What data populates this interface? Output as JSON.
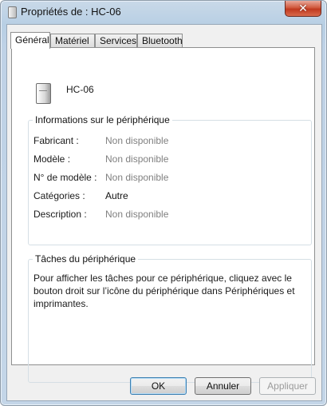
{
  "window": {
    "title": "Propriétés de : HC-06",
    "close_glyph": "✕"
  },
  "tabs": [
    {
      "label": "Général",
      "active": true
    },
    {
      "label": "Matériel",
      "active": false
    },
    {
      "label": "Services",
      "active": false
    },
    {
      "label": "Bluetooth",
      "active": false
    }
  ],
  "device": {
    "name": "HC-06",
    "icon": "device-icon"
  },
  "info": {
    "legend": "Informations sur le périphérique",
    "rows": [
      {
        "label": "Fabricant :",
        "value": "Non disponible"
      },
      {
        "label": "Modèle :",
        "value": "Non disponible"
      },
      {
        "label": "N° de modèle :",
        "value": "Non disponible"
      },
      {
        "label": "Catégories :",
        "value": "Autre"
      },
      {
        "label": "Description :",
        "value": "Non disponible"
      }
    ]
  },
  "tasks": {
    "legend": "Tâches du périphérique",
    "text": "Pour afficher les tâches pour ce périphérique, cliquez avec le bouton droit sur l’icône du périphérique dans Périphériques et imprimantes."
  },
  "buttons": {
    "ok": "OK",
    "cancel": "Annuler",
    "apply": "Appliquer"
  }
}
